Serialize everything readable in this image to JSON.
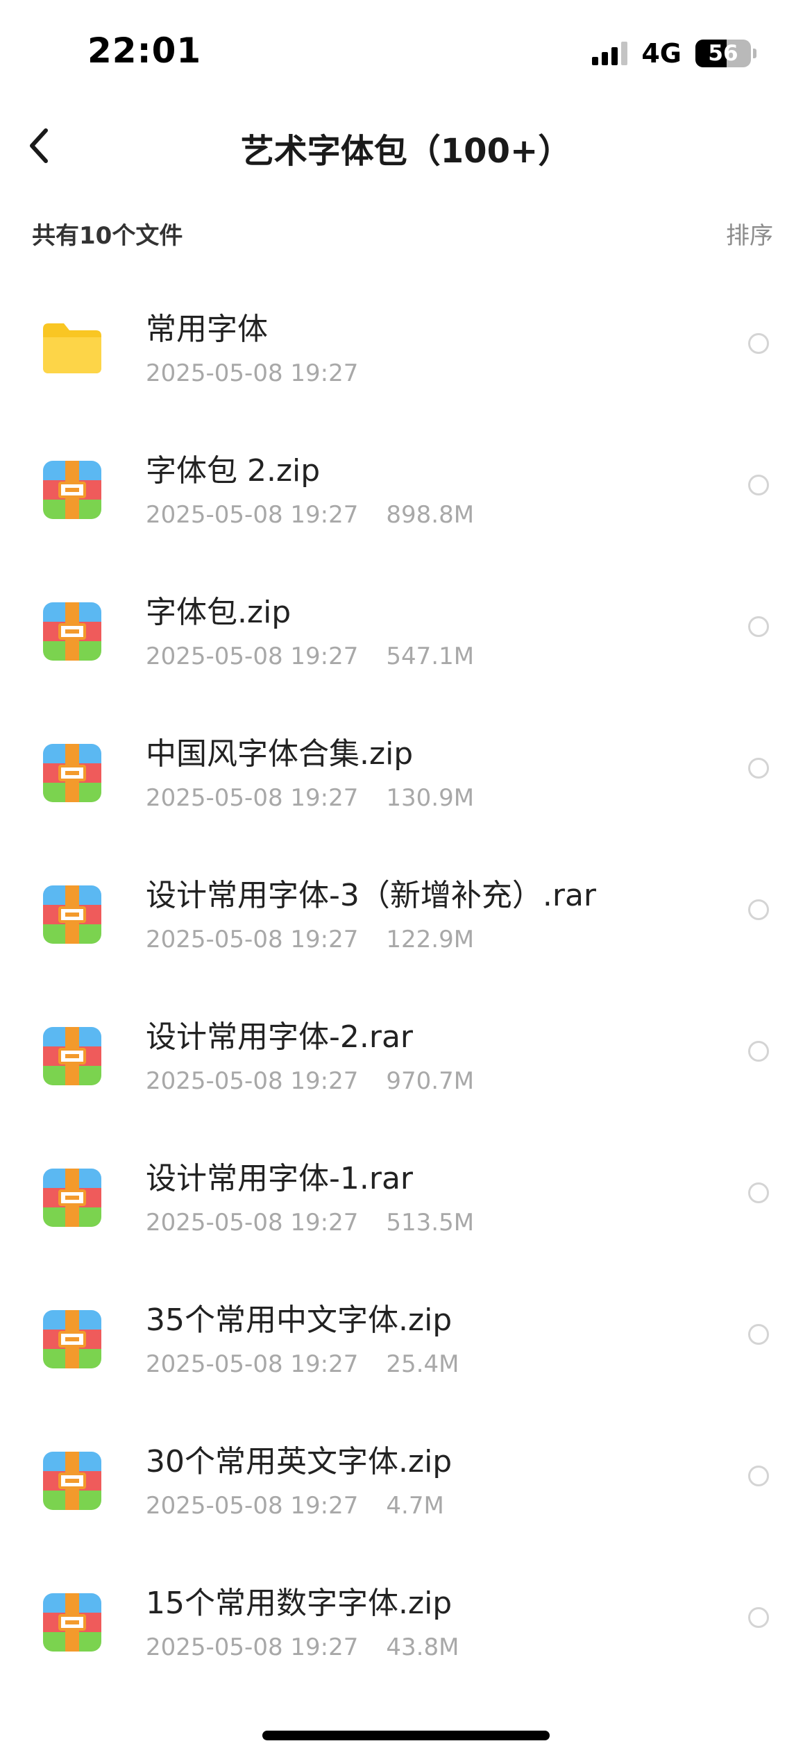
{
  "status_bar": {
    "time": "22:01",
    "network": "4G",
    "battery": "56",
    "battery_level_percent": 56
  },
  "header": {
    "title": "艺术字体包（100+）",
    "back_icon": "chevron-left-icon"
  },
  "subheader": {
    "file_count": "共有10个文件",
    "sort_label": "排序"
  },
  "icons": {
    "folder": "folder-icon",
    "archive": "archive-icon"
  },
  "colors": {
    "folder": "#f9c623",
    "archive_blue": "#5bb8f2",
    "archive_red": "#ef5b5b",
    "archive_green": "#7bd34f",
    "archive_strap": "#f39a2c",
    "meta_text": "#a8a8a8"
  },
  "files": [
    {
      "name": "常用字体",
      "date": "2025-05-08 19:27",
      "size": "",
      "type": "folder"
    },
    {
      "name": "字体包 2.zip",
      "date": "2025-05-08 19:27",
      "size": "898.8M",
      "type": "archive"
    },
    {
      "name": "字体包.zip",
      "date": "2025-05-08 19:27",
      "size": "547.1M",
      "type": "archive"
    },
    {
      "name": "中国风字体合集.zip",
      "date": "2025-05-08 19:27",
      "size": "130.9M",
      "type": "archive"
    },
    {
      "name": "设计常用字体-3（新增补充）.rar",
      "date": "2025-05-08 19:27",
      "size": "122.9M",
      "type": "archive"
    },
    {
      "name": "设计常用字体-2.rar",
      "date": "2025-05-08 19:27",
      "size": "970.7M",
      "type": "archive"
    },
    {
      "name": "设计常用字体-1.rar",
      "date": "2025-05-08 19:27",
      "size": "513.5M",
      "type": "archive"
    },
    {
      "name": "35个常用中文字体.zip",
      "date": "2025-05-08 19:27",
      "size": "25.4M",
      "type": "archive"
    },
    {
      "name": "30个常用英文字体.zip",
      "date": "2025-05-08 19:27",
      "size": "4.7M",
      "type": "archive"
    },
    {
      "name": "15个常用数字字体.zip",
      "date": "2025-05-08 19:27",
      "size": "43.8M",
      "type": "archive"
    }
  ]
}
